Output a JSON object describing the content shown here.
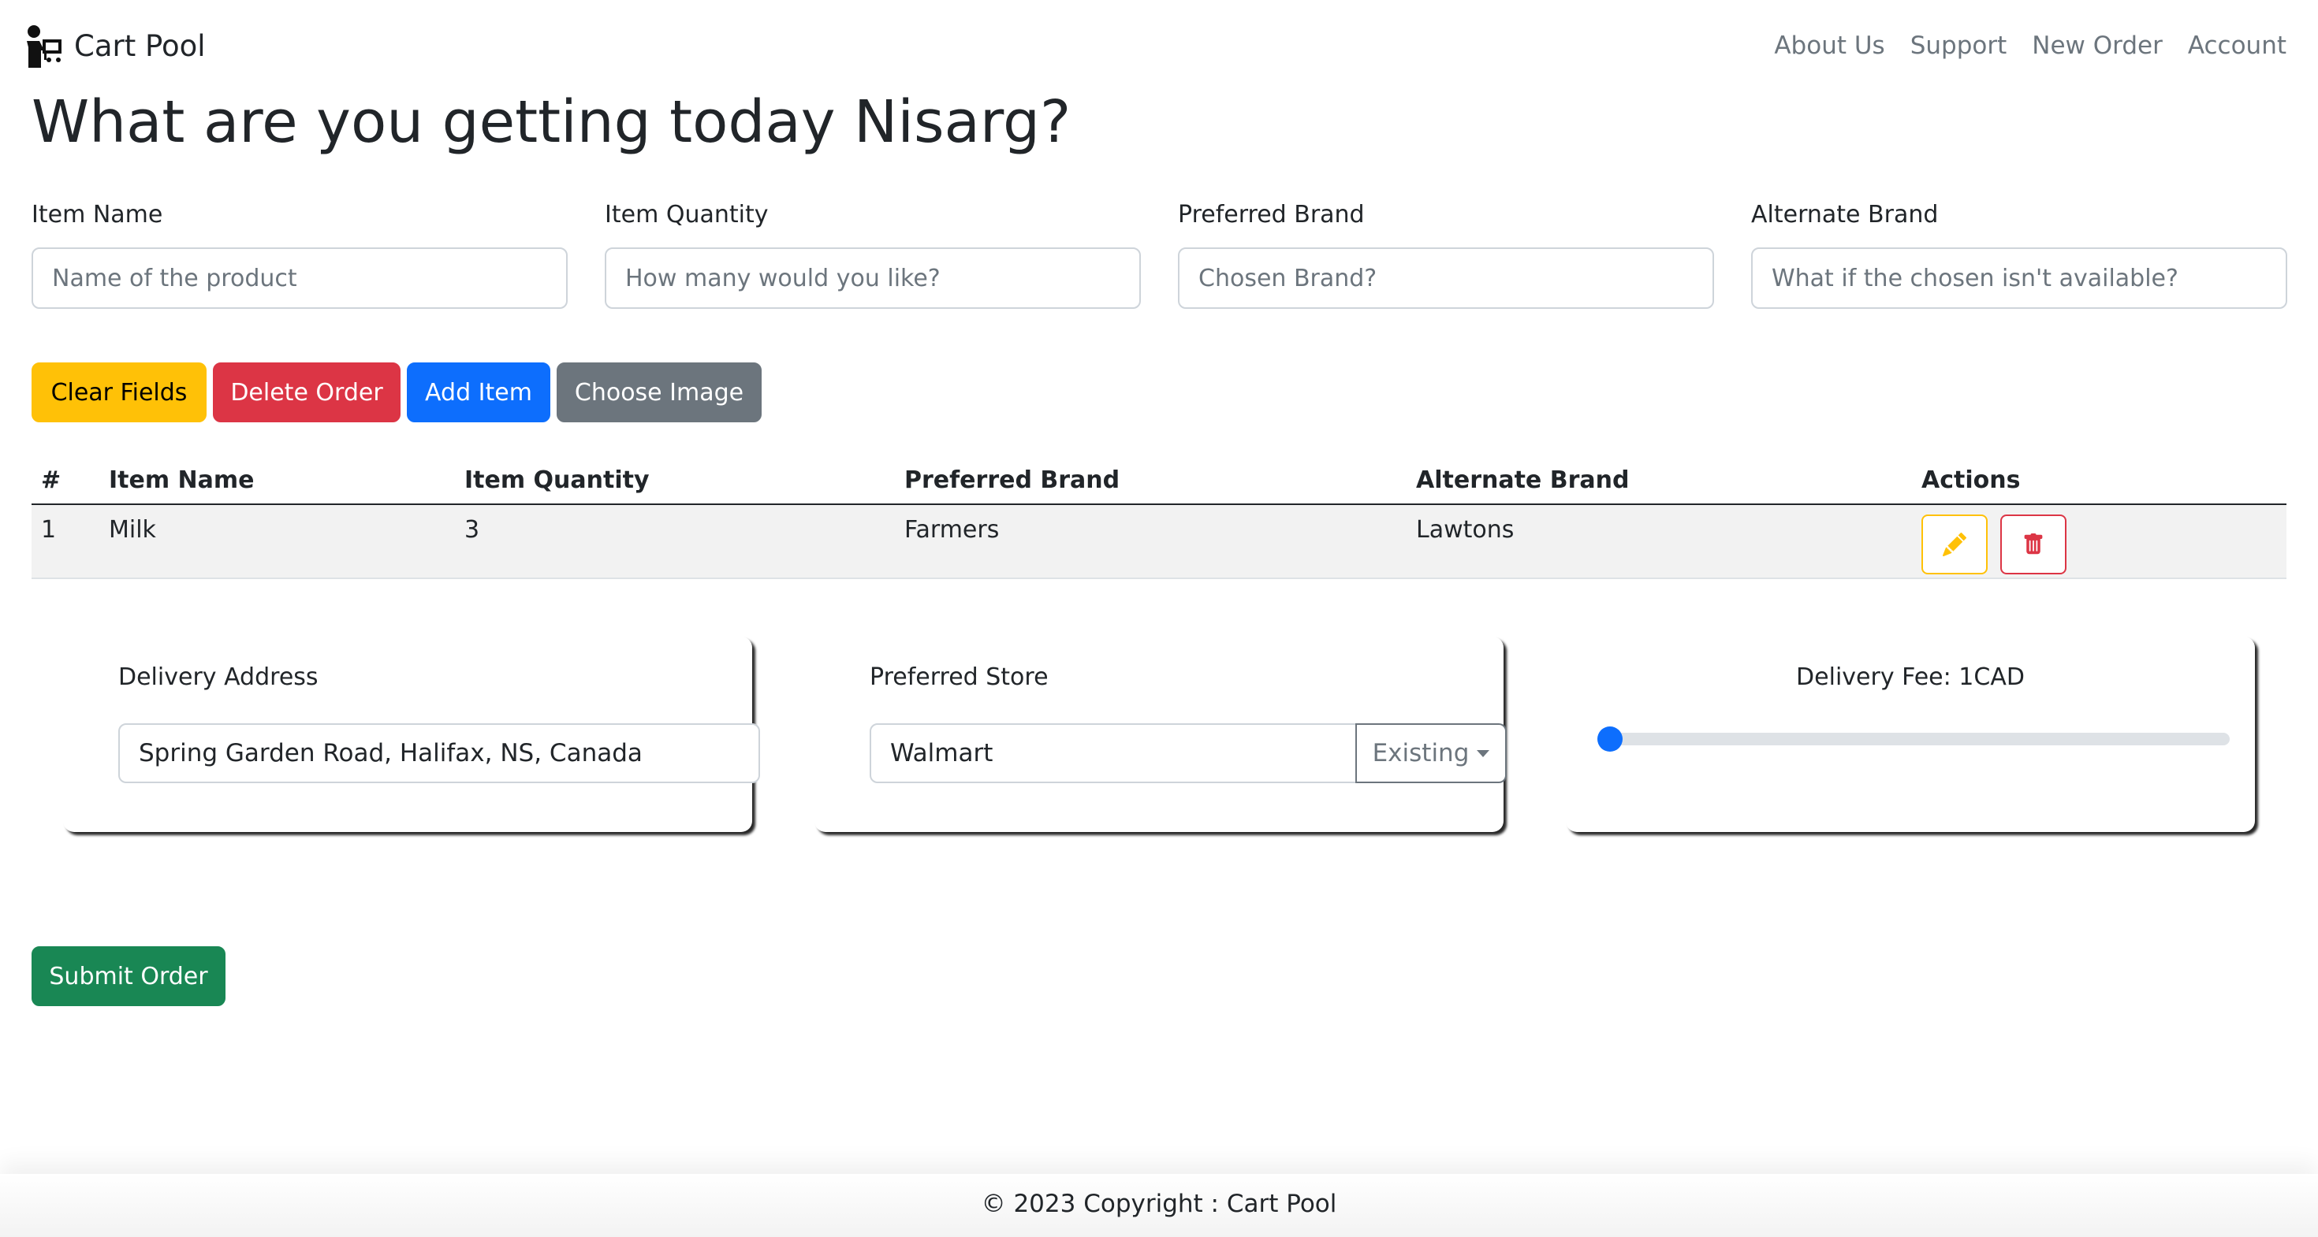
{
  "app": {
    "brand": "Cart Pool",
    "logo_icon": "shopper-with-cart-icon"
  },
  "nav": {
    "links": [
      "About Us",
      "Support",
      "New Order",
      "Account"
    ]
  },
  "heading": "What are you getting today Nisarg?",
  "form": {
    "fields": [
      {
        "label": "Item Name",
        "placeholder": "Name of the product"
      },
      {
        "label": "Item Quantity",
        "placeholder": "How many would you like?"
      },
      {
        "label": "Preferred Brand",
        "placeholder": "Chosen Brand?"
      },
      {
        "label": "Alternate Brand",
        "placeholder": "What if the chosen isn't available?"
      }
    ]
  },
  "buttons": {
    "clear": "Clear Fields",
    "delete_order": "Delete Order",
    "add_item": "Add Item",
    "choose_image": "Choose Image",
    "submit": "Submit Order"
  },
  "table": {
    "headers": [
      "#",
      "Item Name",
      "Item Quantity",
      "Preferred Brand",
      "Alternate Brand",
      "Actions"
    ],
    "rows": [
      {
        "num": "1",
        "item": "Milk",
        "quantity": "3",
        "preferred": "Farmers",
        "alternate": "Lawtons"
      }
    ],
    "action_icons": [
      "pencil-icon",
      "trash-icon"
    ]
  },
  "delivery": {
    "address_label": "Delivery Address",
    "address_value": "Spring Garden Road, Halifax, NS, Canada",
    "store_label": "Preferred Store",
    "store_value": "Walmart",
    "store_dropdown": "Existing",
    "fee_label": "Delivery Fee: 1CAD",
    "fee_slider_fraction": 0.0
  },
  "footer": "© 2023 Copyright : Cart Pool",
  "colors": {
    "warning": "#ffc107",
    "danger": "#dc3545",
    "primary": "#0d6efd",
    "secondary": "#6c757d",
    "success": "#198754"
  }
}
